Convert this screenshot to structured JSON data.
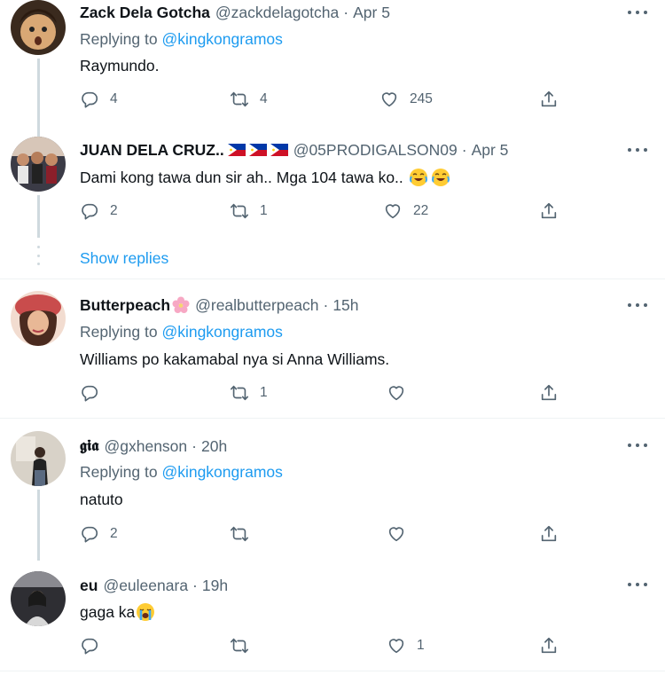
{
  "colors": {
    "accent": "#1d9bf0",
    "secondary_text": "#536471",
    "primary_text": "#0f1419",
    "thread_line": "#cfd9de"
  },
  "show_replies_label": "Show replies",
  "tweets": [
    {
      "name": "Zack Dela Gotcha",
      "handle": "@zackdelagotcha",
      "dot": "·",
      "time": "Apr 5",
      "replying_prefix": "Replying to",
      "replying_mention": "@kingkongramos",
      "text": "Raymundo.",
      "replies": "4",
      "retweets": "4",
      "likes": "245"
    },
    {
      "name": "JUAN DELA CRUZ..",
      "handle": "@05PRODIGALSON09",
      "dot": "·",
      "time": "Apr 5",
      "text": "Dami kong tawa dun sir ah.. Mga 104 tawa ko..",
      "replies": "2",
      "retweets": "1",
      "likes": "22"
    },
    {
      "name": "Butterpeach",
      "handle": "@realbutterpeach",
      "dot": "·",
      "time": "15h",
      "replying_prefix": "Replying to",
      "replying_mention": "@kingkongramos",
      "text": "Williams po kakamabal nya si Anna Williams.",
      "replies": "",
      "retweets": "1",
      "likes": ""
    },
    {
      "name": "𝖌𝖎𝖆",
      "handle": "@gxhenson",
      "dot": "·",
      "time": "20h",
      "replying_prefix": "Replying to",
      "replying_mention": "@kingkongramos",
      "text": "natuto",
      "replies": "2",
      "retweets": "",
      "likes": ""
    },
    {
      "name": "eu",
      "handle": "@euleenara",
      "dot": "·",
      "time": "19h",
      "text": "gaga ka",
      "replies": "",
      "retweets": "",
      "likes": "1"
    }
  ],
  "icons": [
    "more-icon",
    "reply-icon",
    "retweet-icon",
    "like-icon",
    "share-icon",
    "ph-flag-icon",
    "cherry-blossom-icon",
    "crying-laughing-emoji",
    "loudly-crying-emoji"
  ]
}
